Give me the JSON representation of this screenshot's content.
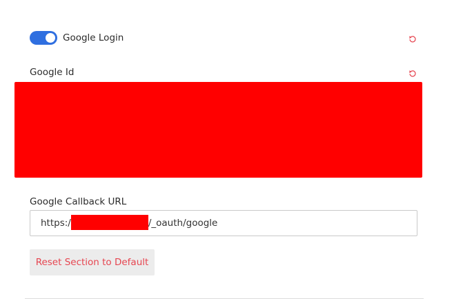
{
  "google_login": {
    "label": "Google Login",
    "enabled": true,
    "reset_icon": "reset-icon"
  },
  "google_id": {
    "label": "Google Id",
    "reset_icon": "reset-icon"
  },
  "callback_url": {
    "label": "Google Callback URL",
    "value_prefix": "https:/",
    "value_suffix": "/_oauth/google"
  },
  "reset_button": {
    "label": "Reset Section to Default"
  },
  "colors": {
    "accent": "#2f6fe0",
    "danger": "#e64550",
    "redaction": "#ff0000"
  }
}
